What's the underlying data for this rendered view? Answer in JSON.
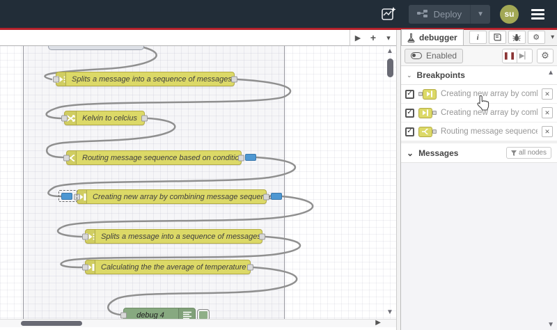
{
  "colors": {
    "header_bg": "#222d38",
    "accent_red": "#b5212b",
    "node_yellow": "#dcd967",
    "debug_green": "#87a980",
    "breakpoint_blue": "#4d97d2"
  },
  "header": {
    "deploy_label": "Deploy",
    "avatar_text": "su"
  },
  "flow_tabbar": {
    "scroll_right": "▶",
    "add": "+",
    "list": "▾"
  },
  "canvas": {
    "nodes": [
      {
        "type": "split",
        "label": "Splits a message into a sequence of messages."
      },
      {
        "type": "change",
        "label": "Kelvin to celcius"
      },
      {
        "type": "switch",
        "label": "Routing message sequence based on condition"
      },
      {
        "type": "join",
        "label": "Creating new array by combining message sequence"
      },
      {
        "type": "split",
        "label": "Splits a message into a sequence of messages."
      },
      {
        "type": "join",
        "label": "Calculating the the average of temperature"
      },
      {
        "type": "debug",
        "label": "debug 4"
      }
    ]
  },
  "sidebar": {
    "tab_label": "debugger",
    "enabled_label": "Enabled",
    "pause_glyph": "❚❚",
    "step_glyph": "▶▏",
    "gear_glyph": "⚙",
    "info_glyph": "i",
    "caret_glyph": "▾",
    "breakpoints": {
      "title": "Breakpoints",
      "check_glyph": "✓",
      "close_glyph": "✕",
      "items": [
        {
          "label": "Creating new array by combining message sequence",
          "port": "input"
        },
        {
          "label": "Creating new array by combining message sequence",
          "port": "output"
        },
        {
          "label": "Routing message sequence based on condition",
          "port": "output"
        }
      ]
    },
    "messages": {
      "title": "Messages",
      "filter_label": "all nodes"
    }
  },
  "scroll": {
    "up": "▲",
    "down": "▼",
    "right": "▶"
  }
}
